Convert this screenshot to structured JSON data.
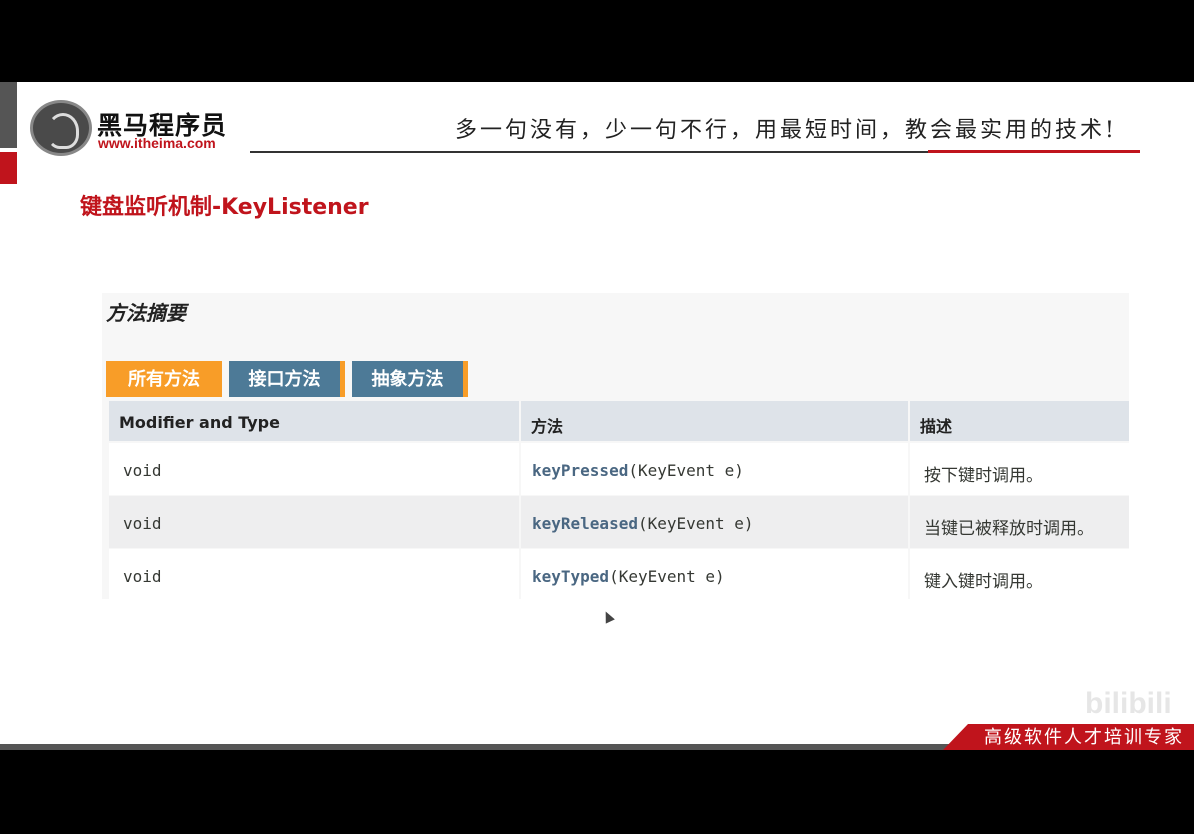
{
  "header": {
    "brand_name": "黑马程序员",
    "brand_url": "www.itheima.com",
    "slogan": "多一句没有，少一句不行，用最短时间，教会最实用的技术!"
  },
  "slide_title": "键盘监听机制-KeyListener",
  "panel": {
    "title": "方法摘要",
    "tabs": [
      {
        "label": "所有方法",
        "active": true
      },
      {
        "label": "接口方法",
        "active": false
      },
      {
        "label": "抽象方法",
        "active": false
      }
    ],
    "columns": [
      "Modifier and Type",
      "方法",
      "描述"
    ],
    "rows": [
      {
        "type": "void",
        "method": "keyPressed",
        "params": "(KeyEvent e)",
        "desc": "按下键时调用。"
      },
      {
        "type": "void",
        "method": "keyReleased",
        "params": "(KeyEvent e)",
        "desc": "当键已被释放时调用。"
      },
      {
        "type": "void",
        "method": "keyTyped",
        "params": "(KeyEvent e)",
        "desc": "键入键时调用。"
      }
    ]
  },
  "footer": {
    "tagline": "高级软件人才培训专家",
    "watermark": "bilibili"
  },
  "colors": {
    "brand_red": "#c0141c",
    "tab_active": "#f89d28",
    "tab_inactive": "#4d7a97",
    "header_row": "#dee3e9",
    "method_link": "#4a6782"
  }
}
